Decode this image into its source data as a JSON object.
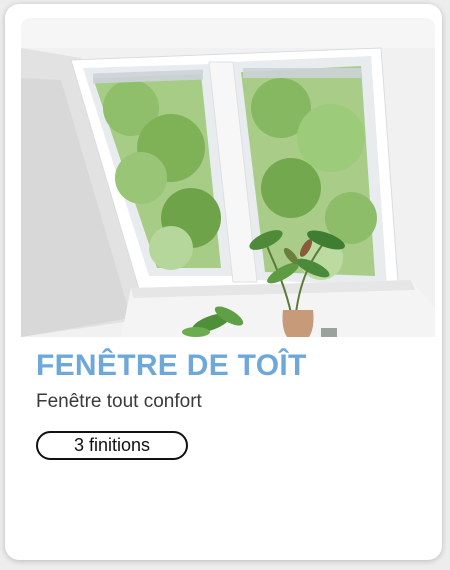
{
  "product_card": {
    "image": {
      "alt_subject": "roof-window-photo"
    },
    "title": "FENÊTRE DE TOÎT",
    "subtitle": "Fenêtre tout confort",
    "finishes_badge": "3 finitions"
  },
  "colors": {
    "title": "#6ea8da",
    "subtitle": "#3a3a3a",
    "badge_border": "#111111",
    "card_background": "#ffffff",
    "page_background": "#ededed"
  }
}
